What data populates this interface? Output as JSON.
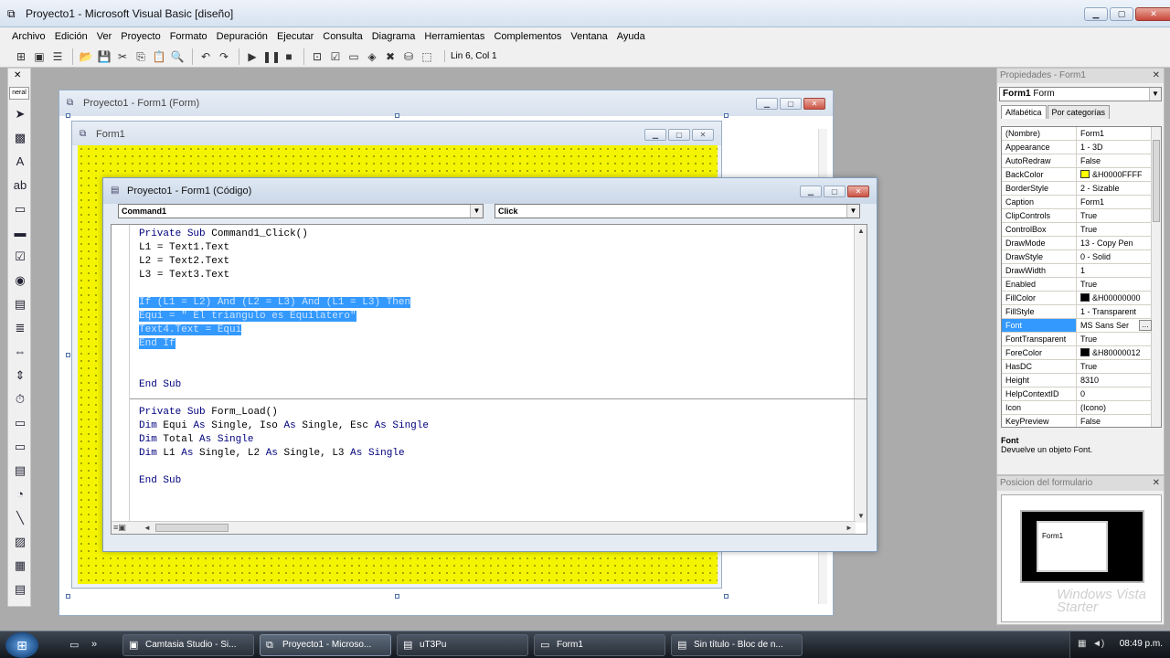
{
  "window": {
    "title": "Proyecto1 - Microsoft Visual Basic [diseño]",
    "min": "▁",
    "max": "▢",
    "close": "✕"
  },
  "menu": [
    "Archivo",
    "Edición",
    "Ver",
    "Proyecto",
    "Formato",
    "Depuración",
    "Ejecutar",
    "Consulta",
    "Diagrama",
    "Herramientas",
    "Complementos",
    "Ventana",
    "Ayuda"
  ],
  "toolbar": {
    "icons": [
      "add-project-icon",
      "add-form-icon",
      "menu-editor-icon",
      "open-icon",
      "save-icon",
      "cut-icon",
      "copy-icon",
      "paste-icon",
      "find-icon",
      "undo-icon",
      "redo-icon",
      "run-icon",
      "break-icon",
      "stop-icon",
      "project-explorer-icon",
      "properties-icon",
      "form-layout-icon",
      "object-browser-icon",
      "toolbox-icon",
      "data-view-icon",
      "component-manager-icon"
    ],
    "status": "Lin 6, Col 1"
  },
  "toolbox": {
    "tab_label": "neral",
    "close": "✕",
    "tools": [
      "pointer-icon",
      "picturebox-icon",
      "label-icon",
      "textbox-icon",
      "frame-icon",
      "commandbutton-icon",
      "checkbox-icon",
      "optionbutton-icon",
      "combobox-icon",
      "listbox-icon",
      "hscrollbar-icon",
      "vscrollbar-icon",
      "timer-icon",
      "drivelistbox-icon",
      "dirlistbox-icon",
      "filelistbox-icon",
      "shape-icon",
      "line-icon",
      "image-icon",
      "data-icon",
      "ole-icon"
    ]
  },
  "designer": {
    "title": "Proyecto1 - Form1 (Form)",
    "form_title": "Form1"
  },
  "code_window": {
    "title": "Proyecto1 - Form1 (Código)",
    "object_combo": "Command1",
    "procedure_combo": "Click",
    "lines": [
      "Private Sub Command1_Click()",
      "L1 = Text1.Text",
      "L2 = Text2.Text",
      "L3 = Text3.Text",
      "",
      "If (L1 = L2) And (L2 = L3) And (L1 = L3) Then",
      "Equi = \" El triangulo es Equilatero\"",
      "Text4.Text = Equi",
      "End If",
      "",
      "",
      "End Sub",
      "",
      "Private Sub Form_Load()",
      "Dim Equi As Single, Iso As Single, Esc As Single",
      "Dim Total As Single",
      "Dim L1 As Single, L2 As Single, L3 As Single",
      "",
      "End Sub"
    ],
    "selected_lines": [
      5,
      6,
      7,
      8
    ],
    "separator_after_line": 12
  },
  "properties": {
    "title": "Propiedades - Form1",
    "object_name": "Form1",
    "object_type": "Form",
    "tabs": [
      "Alfabética",
      "Por categorías"
    ],
    "rows": [
      {
        "name": "(Nombre)",
        "value": "Form1"
      },
      {
        "name": "Appearance",
        "value": "1 - 3D"
      },
      {
        "name": "AutoRedraw",
        "value": "False"
      },
      {
        "name": "BackColor",
        "value": "&H0000FFFF",
        "swatch": "#ffff00"
      },
      {
        "name": "BorderStyle",
        "value": "2 - Sizable"
      },
      {
        "name": "Caption",
        "value": "Form1"
      },
      {
        "name": "ClipControls",
        "value": "True"
      },
      {
        "name": "ControlBox",
        "value": "True"
      },
      {
        "name": "DrawMode",
        "value": "13 - Copy Pen"
      },
      {
        "name": "DrawStyle",
        "value": "0 - Solid"
      },
      {
        "name": "DrawWidth",
        "value": "1"
      },
      {
        "name": "Enabled",
        "value": "True"
      },
      {
        "name": "FillColor",
        "value": "&H00000000",
        "swatch": "#000000"
      },
      {
        "name": "FillStyle",
        "value": "1 - Transparent"
      },
      {
        "name": "Font",
        "value": "MS Sans Ser",
        "selected": true
      },
      {
        "name": "FontTransparent",
        "value": "True"
      },
      {
        "name": "ForeColor",
        "value": "&H80000012",
        "swatch": "#000000"
      },
      {
        "name": "HasDC",
        "value": "True"
      },
      {
        "name": "Height",
        "value": "8310"
      },
      {
        "name": "HelpContextID",
        "value": "0"
      },
      {
        "name": "Icon",
        "value": "(Icono)"
      },
      {
        "name": "KeyPreview",
        "value": "False"
      }
    ],
    "desc_title": "Font",
    "desc_text": "Devuelve un objeto Font."
  },
  "form_layout": {
    "title": "Posicion del formulario",
    "mini_form": "Form1",
    "watermark": "Windows Vista Starter"
  },
  "taskbar": {
    "tasks": [
      {
        "label": "Camtasia Studio - Si...",
        "icon": "camtasia-icon"
      },
      {
        "label": "Proyecto1 - Microso...",
        "icon": "vb-icon",
        "active": true
      },
      {
        "label": "uT3Pu",
        "icon": "folder-icon"
      },
      {
        "label": "Form1",
        "icon": "form-icon"
      },
      {
        "label": "Sin título - Bloc de n...",
        "icon": "notepad-icon"
      }
    ],
    "clock": "08:49 p.m."
  },
  "colors": {
    "form_back": "#ffff00",
    "selection": "#3399ff",
    "keyword": "#00007f"
  }
}
